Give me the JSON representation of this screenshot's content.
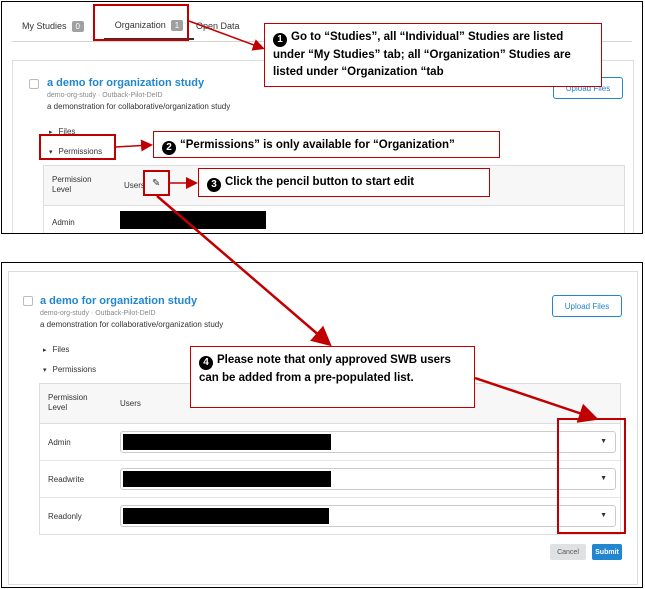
{
  "tabs": [
    {
      "label": "My Studies",
      "count": "0"
    },
    {
      "label": "Organization",
      "count": "1"
    },
    {
      "label": "Open Data"
    }
  ],
  "study": {
    "title": "a demo for organization study",
    "subtitle": "demo-org-study · Outback-Pilot-DeID",
    "description": "a demonstration for collaborative/organization study",
    "upload_label": "Upload Files",
    "files_label": "Files",
    "permissions_label": "Permissions"
  },
  "permissions": {
    "level_header": "Permission Level",
    "users_header": "Users",
    "rows": [
      {
        "level": "Admin"
      },
      {
        "level": "Readwrite"
      },
      {
        "level": "Readonly"
      }
    ],
    "cancel_label": "Cancel",
    "submit_label": "Submit"
  },
  "annotations": {
    "step1": {
      "number": "1",
      "text": "Go to “Studies”, all “Individual” Studies are listed under “My Studies” tab; all “Organization” Studies are listed under “Organization “tab"
    },
    "step2": {
      "number": "2",
      "text": "“Permissions” is only available for “Organization”"
    },
    "step3": {
      "number": "3",
      "text": "Click the pencil button to start edit"
    },
    "step4": {
      "number": "4",
      "text": "Please note that only approved SWB users can be added from a pre-populated list."
    }
  },
  "colors": {
    "accent": "#2185d0",
    "annotation": "#c00000"
  },
  "icons": {
    "edit": "pencil-icon",
    "dropdown": "caret-down-icon",
    "expand": "caret-right-icon",
    "collapse": "caret-down-icon"
  }
}
